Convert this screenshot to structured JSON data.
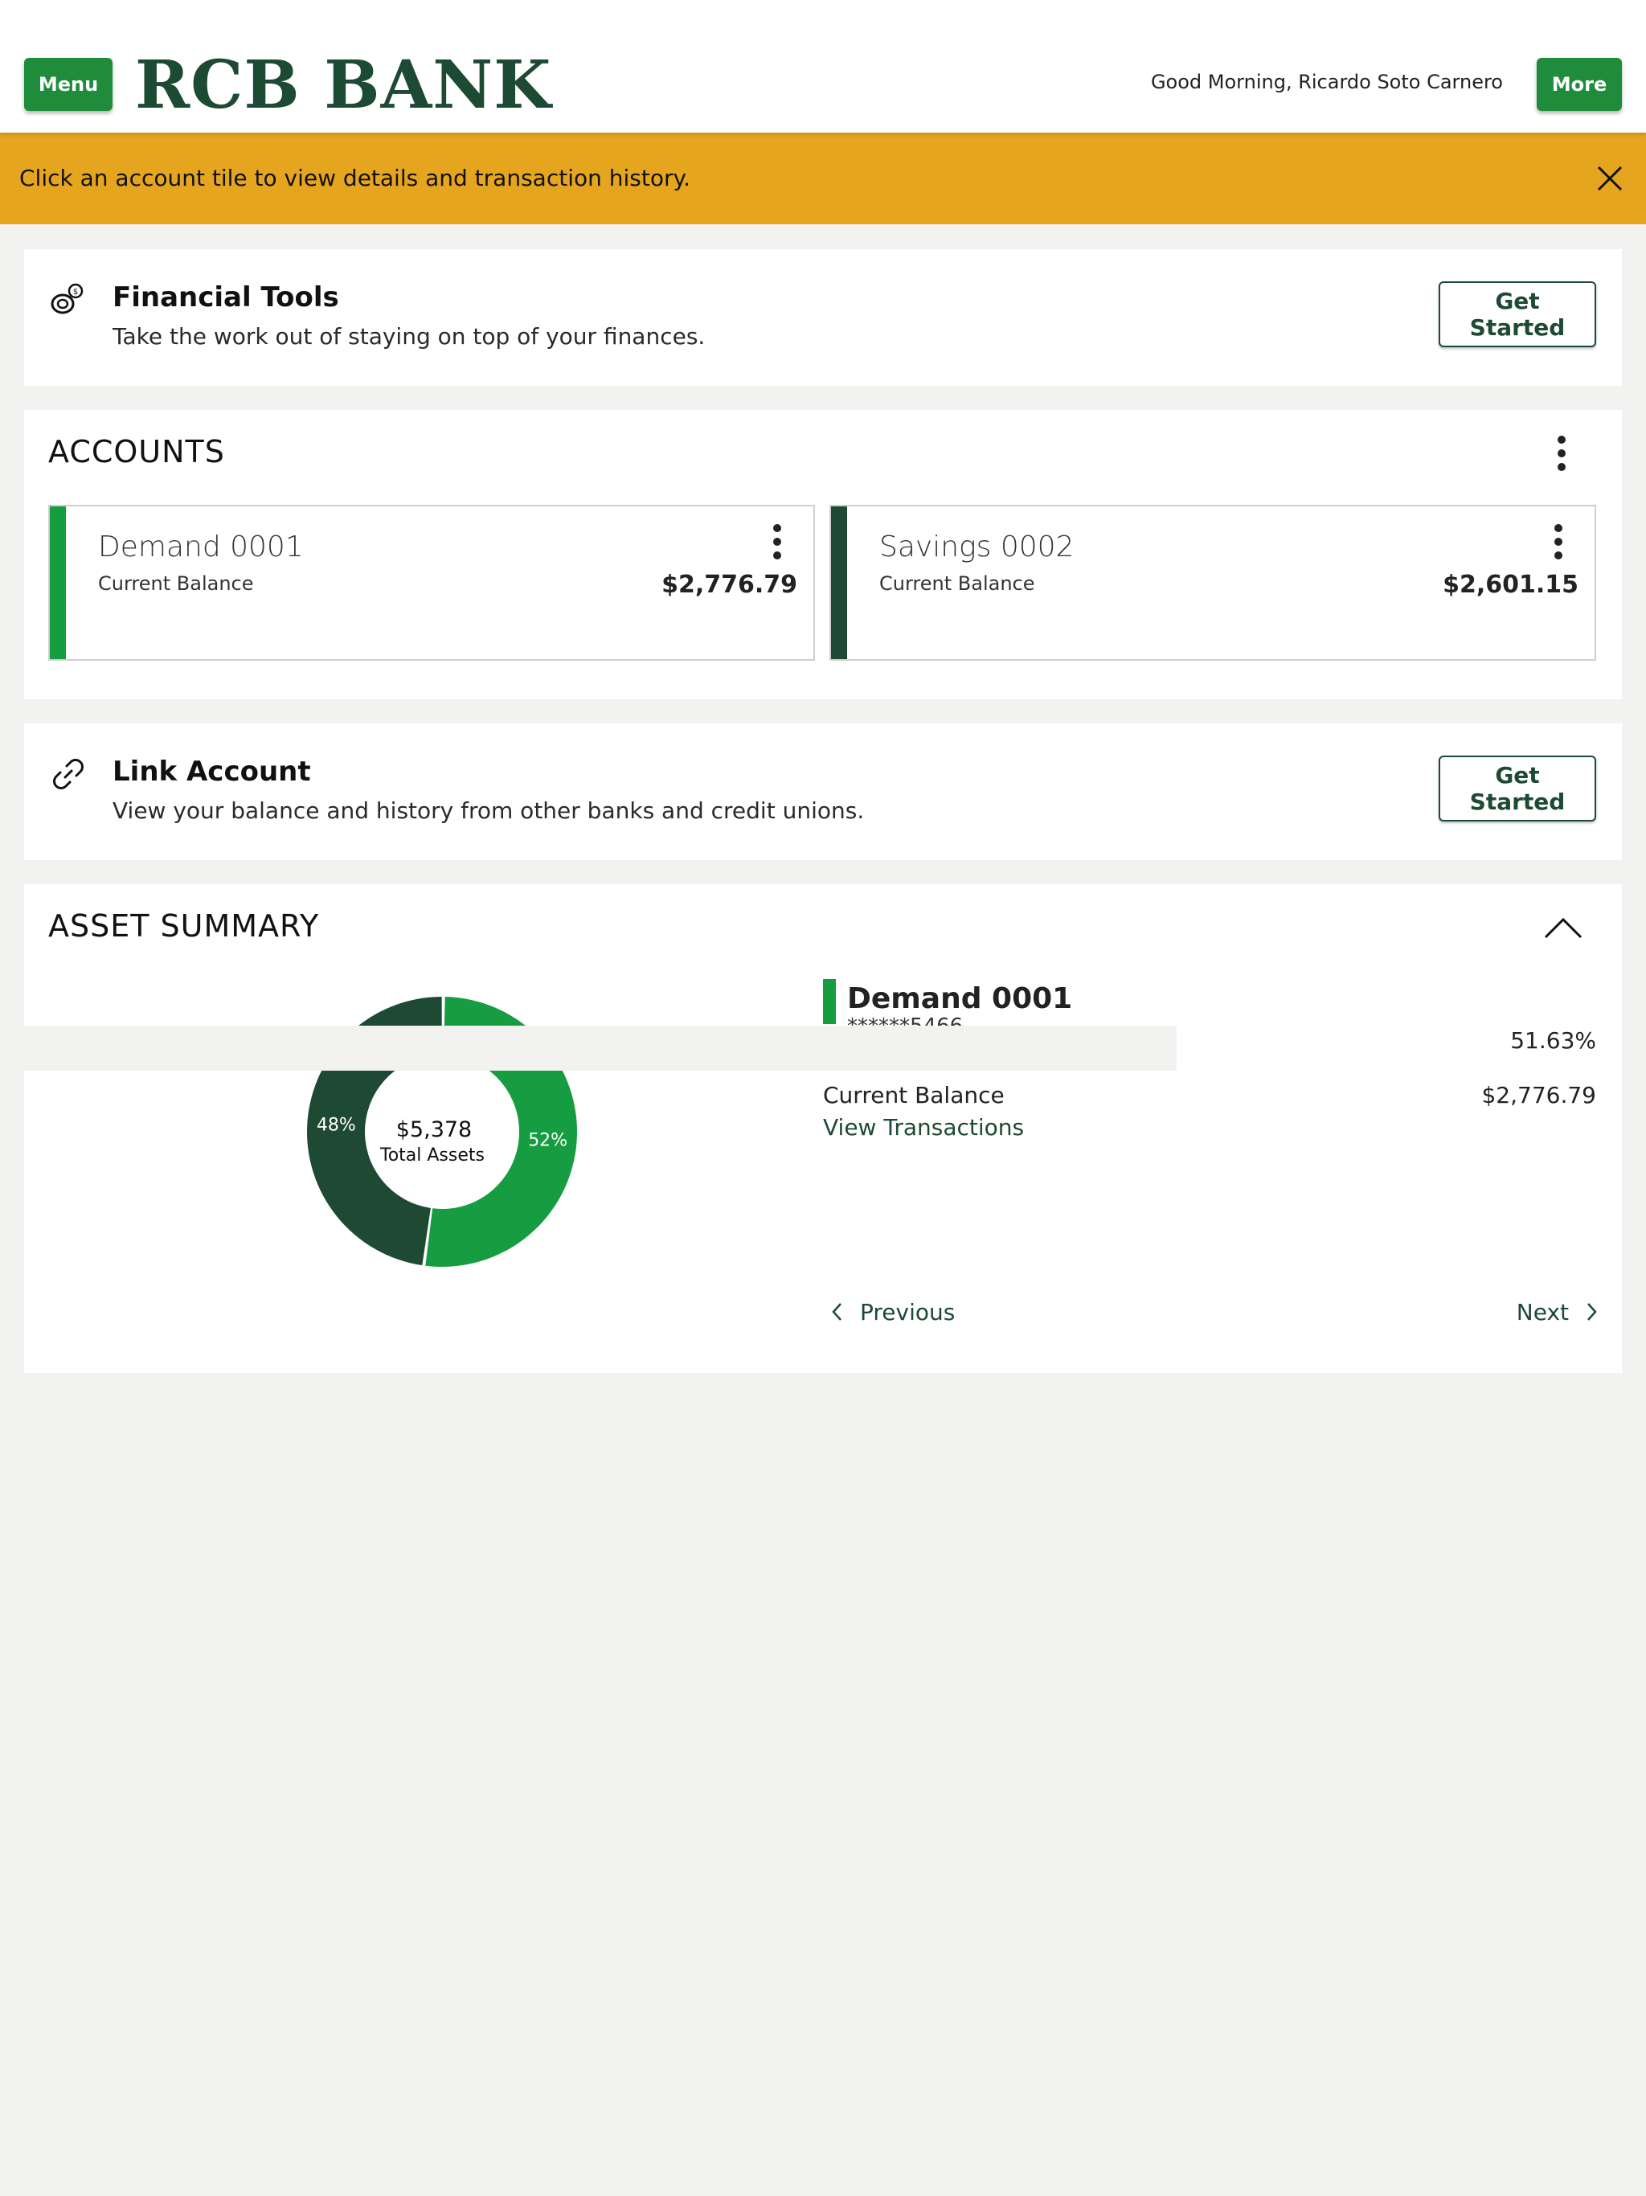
{
  "header": {
    "menu_label": "Menu",
    "logo_text": "RCB BANK",
    "greeting": "Good Morning, Ricardo Soto Carnero",
    "more_label": "More"
  },
  "banner": {
    "text": "Click an account tile to view details and transaction history.",
    "close_icon": "close-icon"
  },
  "financial_tools": {
    "icon": "coins-icon",
    "title": "Financial Tools",
    "subtitle": "Take the work out of staying on top of your finances.",
    "button_label": "Get Started"
  },
  "accounts": {
    "heading": "ACCOUNTS",
    "tiles": [
      {
        "name": "Demand 0001",
        "label": "Current Balance",
        "amount": "$2,776.79",
        "color": "#169c41"
      },
      {
        "name": "Savings 0002",
        "label": "Current Balance",
        "amount": "$2,601.15",
        "color": "#1e4a33"
      }
    ]
  },
  "link_account": {
    "icon": "link-icon",
    "title": "Link Account",
    "subtitle": "View your balance and history from other banks and credit unions.",
    "button_label": "Get Started"
  },
  "asset_summary": {
    "heading": "ASSET SUMMARY",
    "collapse_icon": "chevron-up-icon",
    "center_value": "$5,378",
    "center_label": "Total Assets",
    "detail": {
      "name": "Demand 0001",
      "masked_number": "******5466",
      "percent": "51.63%",
      "balance_label": "Current Balance",
      "balance_value": "$2,776.79",
      "view_link": "View Transactions"
    },
    "prev_label": "Previous",
    "next_label": "Next"
  },
  "chart_data": {
    "type": "pie",
    "categories": [
      "Demand 0001",
      "Savings 0002"
    ],
    "values": [
      52,
      48
    ],
    "labels": [
      "52%",
      "48%"
    ],
    "colors": [
      "#169c41",
      "#1e4a33"
    ],
    "title": "",
    "center_text": "$5,378",
    "center_subtext": "Total Assets"
  }
}
